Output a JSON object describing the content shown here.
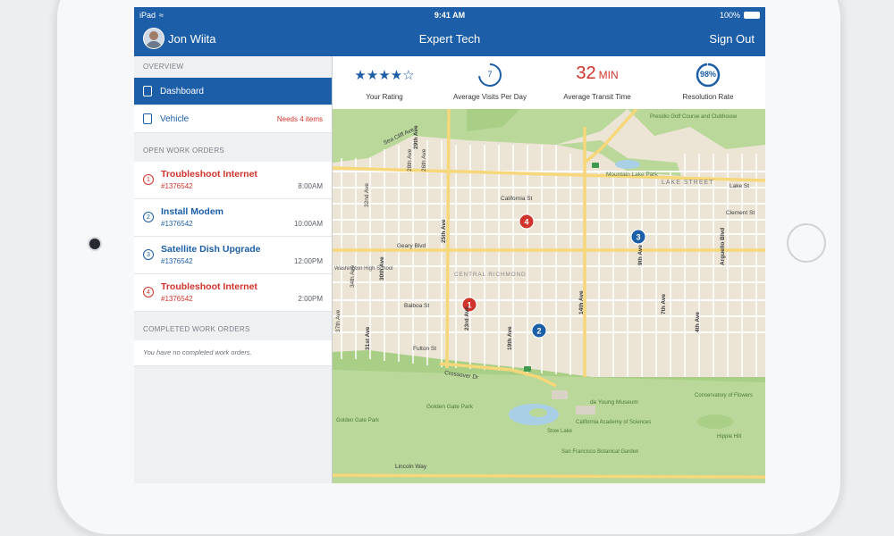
{
  "device": {
    "model": "iPad"
  },
  "status_bar": {
    "carrier": "iPad",
    "time": "9:41 AM",
    "battery": "100%"
  },
  "header": {
    "user_name": "Jon Wiita",
    "app_title": "Expert Tech",
    "sign_out": "Sign Out"
  },
  "sidebar": {
    "overview_header": "OVERVIEW",
    "nav": [
      {
        "label": "Dashboard",
        "icon": "document-icon",
        "active": true
      },
      {
        "label": "Vehicle",
        "icon": "truck-icon",
        "badge": "Needs 4 items"
      }
    ],
    "open_header": "OPEN WORK ORDERS",
    "work_orders": [
      {
        "num": "1",
        "title": "Troubleshoot Internet",
        "id": "#1376542",
        "time": "8:00AM",
        "status": "red"
      },
      {
        "num": "2",
        "title": "Install Modem",
        "id": "#1376542",
        "time": "10:00AM",
        "status": "blue"
      },
      {
        "num": "3",
        "title": "Satellite Dish Upgrade",
        "id": "#1376542",
        "time": "12:00PM",
        "status": "blue"
      },
      {
        "num": "4",
        "title": "Troubleshoot Internet",
        "id": "#1376542",
        "time": "2:00PM",
        "status": "red"
      }
    ],
    "completed_header": "COMPLETED WORK ORDERS",
    "completed_empty": "You have no completed work orders."
  },
  "stats": {
    "rating": {
      "stars": "★★★★☆",
      "label": "Your Rating",
      "value": 4,
      "max": 5
    },
    "visits": {
      "value": "7",
      "label": "Average Visits Per Day"
    },
    "transit": {
      "value": "32",
      "unit": "MIN",
      "label": "Average Transit Time"
    },
    "resolution": {
      "value": "98%",
      "fraction": 0.98,
      "label": "Resolution Rate"
    }
  },
  "map": {
    "streets": {
      "california": "California St",
      "geary": "Geary Blvd",
      "balboa": "Balboa St",
      "fulton": "Fulton St",
      "crossover": "Crossover Dr",
      "lincoln": "Lincoln Way",
      "lake": "Lake St",
      "lake_street": "LAKE STREET",
      "clement": "Clement St",
      "sea_cliff": "Sea Cliff Ave",
      "ave_25th": "25th Ave",
      "ave_26th": "26th Ave",
      "ave_28th": "28th Ave",
      "ave_29th": "29th Ave",
      "ave_30th": "30th Ave",
      "ave_31st": "31st Ave",
      "ave_23rd": "23rd Ave",
      "ave_19th": "19th Ave",
      "ave_14th": "14th Ave",
      "ave_9th": "9th Ave",
      "ave_8th": "8th Ave",
      "ave_7th": "7th Ave",
      "ave_4th": "4th Ave",
      "arguello": "Arguello Blvd",
      "ave_37th": "37th Ave",
      "ave_34th": "34th Ave",
      "ave_32nd": "32nd Ave"
    },
    "places": {
      "presidio": "Presidio Golf Course and Clubhouse",
      "mountain_lake": "Mountain Lake Park",
      "central_richmond": "CENTRAL RICHMOND",
      "washington": "Washington High School",
      "golden_gate_park": "Golden Gate Park",
      "de_young": "de Young Museum",
      "academy": "California Academy of Sciences",
      "conservatory": "Conservatory of Flowers",
      "stow_lake": "Stow Lake",
      "botanical": "San Francisco Botanical Garden",
      "hippie_hill": "Hippie Hill",
      "gate_park": "Golden Gate Park"
    },
    "markers": [
      {
        "num": "1",
        "status": "red"
      },
      {
        "num": "2",
        "status": "blue"
      },
      {
        "num": "3",
        "status": "blue"
      },
      {
        "num": "4",
        "status": "red"
      }
    ],
    "colors": {
      "red": "#d0332b",
      "blue": "#1c5ea7",
      "park": "#b9d89a",
      "water": "#a8cfe6",
      "road": "#f6d77a",
      "land": "#ece5d6"
    }
  }
}
